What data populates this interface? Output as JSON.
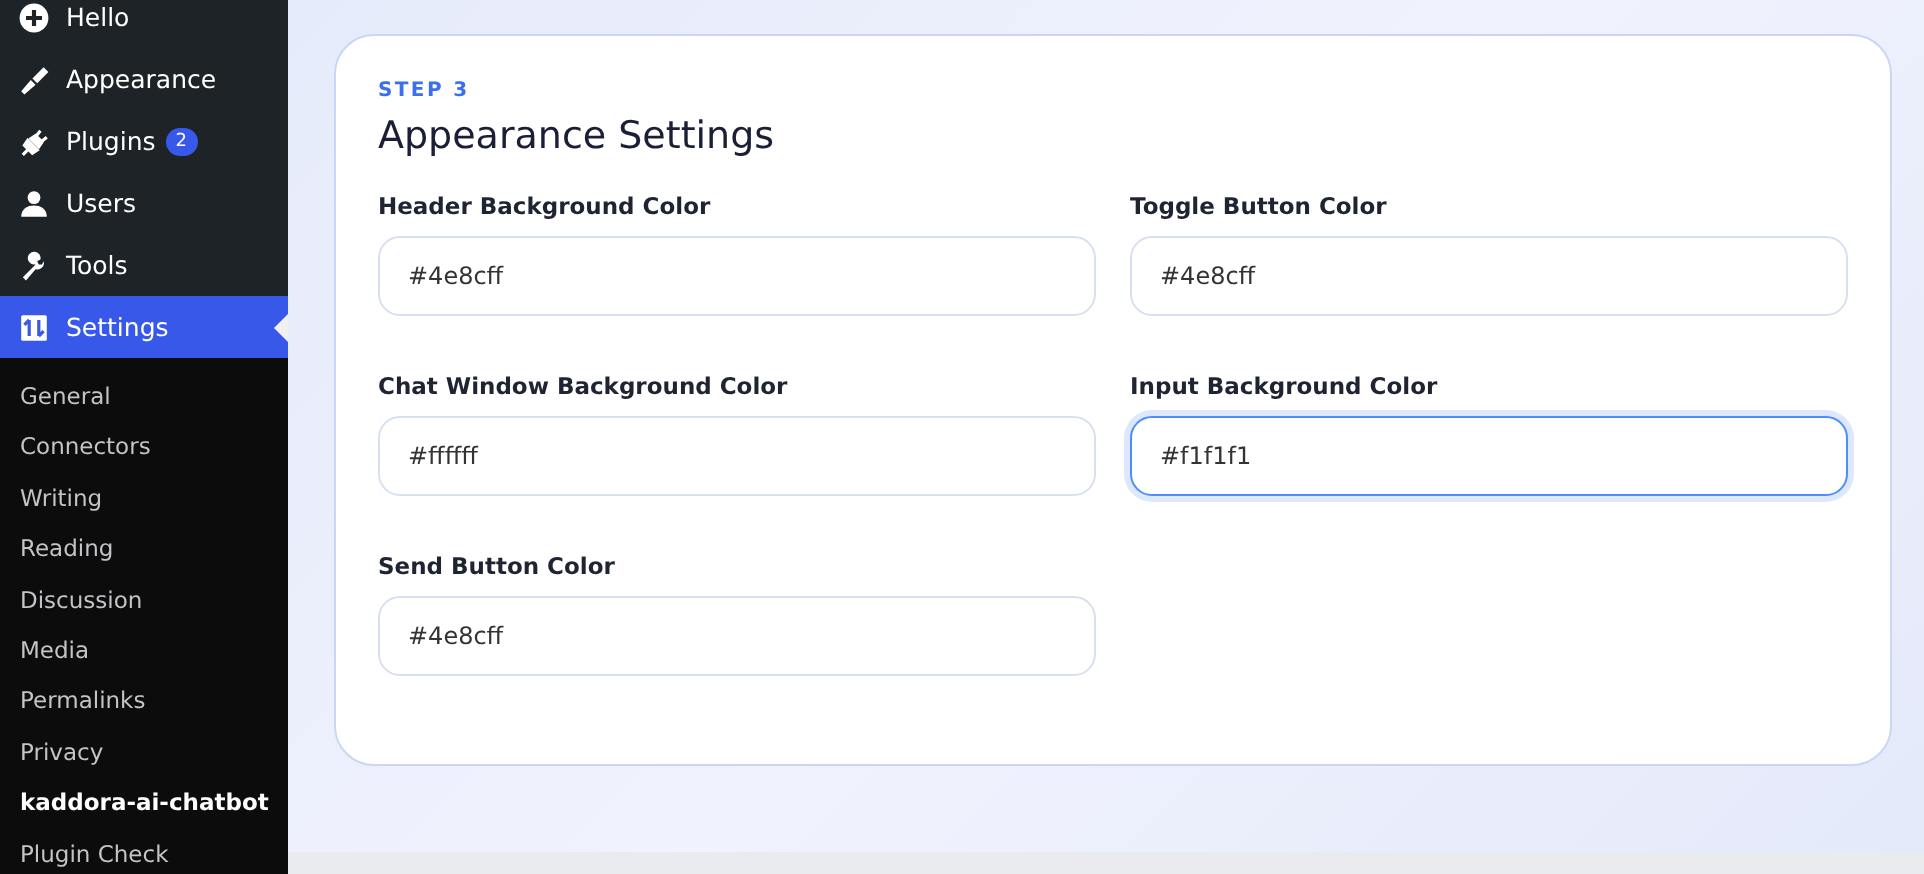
{
  "sidebar": {
    "items": [
      {
        "label": "Hello",
        "kind": "plus",
        "selected": false
      },
      {
        "label": "Appearance",
        "kind": "brush",
        "selected": false
      },
      {
        "label": "Plugins",
        "kind": "plug",
        "selected": false,
        "badge": "2"
      },
      {
        "label": "Users",
        "kind": "user",
        "selected": false
      },
      {
        "label": "Tools",
        "kind": "wrench",
        "selected": false
      },
      {
        "label": "Settings",
        "kind": "settings",
        "selected": true
      }
    ],
    "submenu": [
      {
        "label": "General",
        "selected": false
      },
      {
        "label": "Connectors",
        "selected": false
      },
      {
        "label": "Writing",
        "selected": false
      },
      {
        "label": "Reading",
        "selected": false
      },
      {
        "label": "Discussion",
        "selected": false
      },
      {
        "label": "Media",
        "selected": false
      },
      {
        "label": "Permalinks",
        "selected": false
      },
      {
        "label": "Privacy",
        "selected": false
      },
      {
        "label": "kaddora-ai-chatbot",
        "selected": true
      },
      {
        "label": "Plugin Check",
        "selected": false
      }
    ]
  },
  "card": {
    "step": "STEP 3",
    "title": "Appearance Settings",
    "fields": [
      {
        "label": "Header Background Color",
        "value": "#4e8cff",
        "focused": false
      },
      {
        "label": "Toggle Button Color",
        "value": "#4e8cff",
        "focused": false
      },
      {
        "label": "Chat Window Background Color",
        "value": "#ffffff",
        "focused": false
      },
      {
        "label": "Input Background Color",
        "value": "#f1f1f1",
        "focused": true
      },
      {
        "label": "Send Button Color",
        "value": "#4e8cff",
        "focused": false
      }
    ]
  }
}
